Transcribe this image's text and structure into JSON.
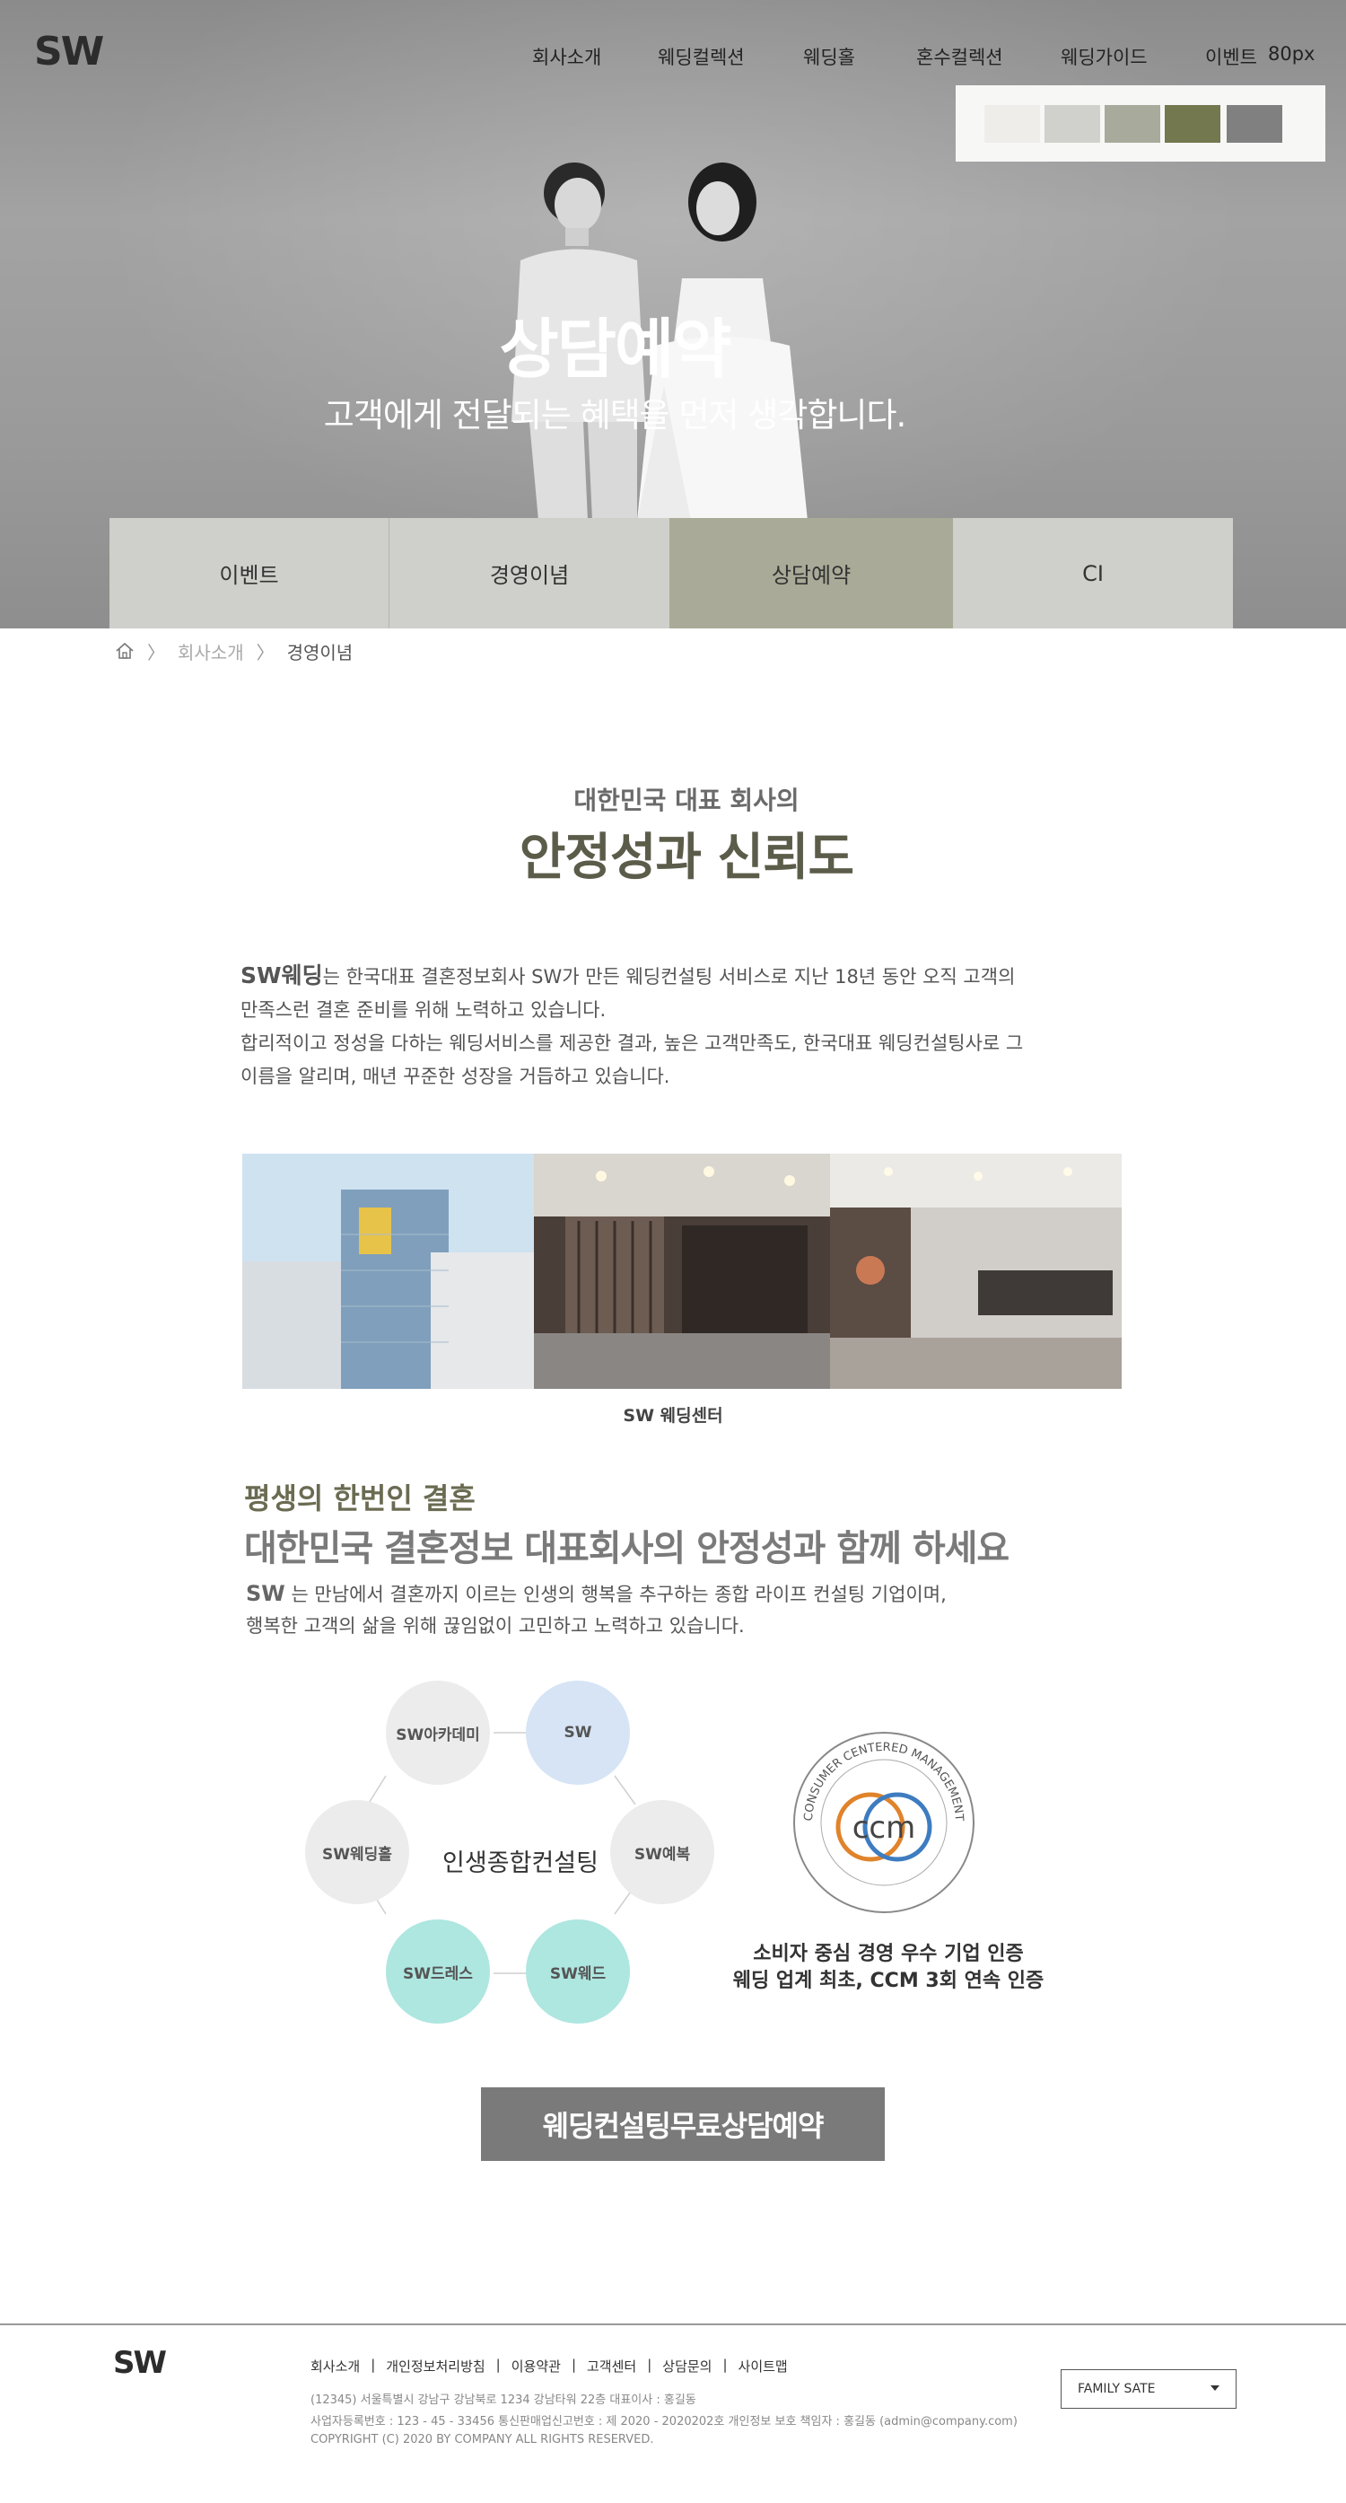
{
  "header": {
    "logo": "SW",
    "nav": [
      "회사소개",
      "웨딩컬렉션",
      "웨딩홀",
      "혼수컬렉션",
      "웨딩가이드",
      "이벤트"
    ],
    "nav_extra": "80px",
    "swatches": [
      "#efedea",
      "#d0d1cc",
      "#a8ab9b",
      "#73784f",
      "#808080"
    ]
  },
  "hero": {
    "title": "상담예약",
    "subtitle": "고객에게 전달되는 혜택을 먼저 생각합니다."
  },
  "subnav": {
    "items": [
      {
        "label": "이벤트",
        "color": "#cfcfcb"
      },
      {
        "label": "경영이념",
        "color": "#cfcfcb"
      },
      {
        "label": "상담예약",
        "color": "#a9ab98"
      },
      {
        "label": "CI",
        "color": "#cfcfcb"
      }
    ]
  },
  "breadcrumb": {
    "home_icon": "home-icon",
    "items": [
      "회사소개",
      "경영이념"
    ]
  },
  "intro": {
    "kicker": "대한민국 대표 회사의",
    "title": "안정성과 신뢰도",
    "p1_lead": "SW웨딩",
    "p1_rest": "는 한국대표 결혼정보회사 SW가 만든 웨딩컨설팅 서비스로 지난 18년 동안 오직 고객의",
    "p1_line2": "만족스런 결혼 준비를 위해 노력하고 있습니다.",
    "p1_line3": "합리적이고 정성을 다하는 웨딩서비스를 제공한 결과, 높은 고객만족도, 한국대표 웨딩컨설팅사로 그",
    "p1_line4": "이름을 알리며, 매년 꾸준한 성장을 거듭하고 있습니다."
  },
  "photos": {
    "caption": "SW 웨딩센터"
  },
  "section2": {
    "kicker": "평생의 한번인 결혼",
    "title": "대한민국 결혼정보 대표회사의 안정성과 함께 하세요",
    "p_lead": "SW",
    "p_rest": " 는 만남에서 결혼까지 이르는 인생의 행복을 추구하는 종합 라이프 컨설팅 기업이며,",
    "p_line2": "행복한 고객의 삶을 위해 끊임없이 고민하고 노력하고 있습니다."
  },
  "diagram": {
    "center": "인생종합컨설팅",
    "nodes": [
      {
        "label": "SW아카데미",
        "color": "#ececec"
      },
      {
        "label": "SW",
        "color": "#d6e4f5"
      },
      {
        "label": "SW예복",
        "color": "#ececec"
      },
      {
        "label": "SW웨드",
        "color": "#aee6e0"
      },
      {
        "label": "SW드레스",
        "color": "#aee6e0"
      },
      {
        "label": "SW웨딩홀",
        "color": "#ececec"
      }
    ]
  },
  "ccm": {
    "badge": "ccm",
    "ring_top": "CONSUMER CENTERED MANAGEMENT",
    "line1": "소비자 중심 경영 우수 기업 인증",
    "line2": "웨딩 업계 최초, CCM 3회 연속 인증"
  },
  "cta": {
    "label": "웨딩컨설팅무료상담예약"
  },
  "footer": {
    "logo": "SW",
    "links": [
      "회사소개",
      "개인정보처리방침",
      "이용약관",
      "고객센터",
      "상담문의",
      "사이트맵"
    ],
    "address": "(12345) 서울특별시 강남구 강남북로 1234 강남타워 22층 대표이사 : 홍길동",
    "registration": "사업자등록번호 : 123 - 45 - 33456 통신판매업신고번호 : 제 2020 - 2020202호 개인정보 보호 책임자 : 홍길동 (admin@company.com)",
    "copyright": "COPYRIGHT (C) 2020 BY COMPANY ALL RIGHTS RESERVED.",
    "family_site": "FAMILY SATE"
  }
}
